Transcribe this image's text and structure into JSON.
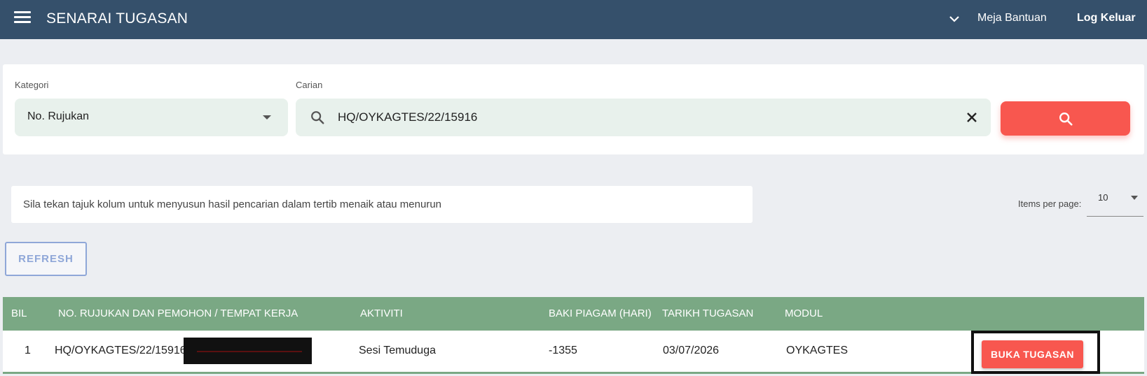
{
  "header": {
    "title": "SENARAI TUGASAN",
    "help_label": "Meja Bantuan",
    "logout_label": "Log Keluar"
  },
  "filter": {
    "category_label": "Kategori",
    "category_value": "No. Rujukan",
    "search_label": "Carian",
    "search_value": "HQ/OYKAGTES/22/15916"
  },
  "hint_text": "Sila tekan tajuk kolum untuk menyusun hasil pencarian dalam tertib menaik atau menurun",
  "paging": {
    "items_per_page_label": "Items per page:",
    "items_per_page_value": "10"
  },
  "refresh_label": "REFRESH",
  "table": {
    "columns": [
      "BIL",
      "NO. RUJUKAN DAN PEMOHON / TEMPAT KERJA",
      "AKTIVITI",
      "BAKI PIAGAM (HARI)",
      "TARIKH TUGASAN",
      "MODUL"
    ],
    "rows": [
      {
        "bil": "1",
        "rujukan": "HQ/OYKAGTES/22/15916",
        "aktiviti": "Sesi Temuduga",
        "baki": "-1355",
        "tarikh": "03/07/2026",
        "modul": "OYKAGTES",
        "action_label": "BUKA TUGASAN"
      }
    ]
  },
  "colors": {
    "topbar": "#35506b",
    "accent_red": "#f8574f",
    "table_header": "#7aa884",
    "input_bg": "#e8f1ec"
  },
  "icons": [
    "menu-icon",
    "chevron-down-icon",
    "search-icon",
    "close-icon",
    "dropdown-caret-icon"
  ]
}
